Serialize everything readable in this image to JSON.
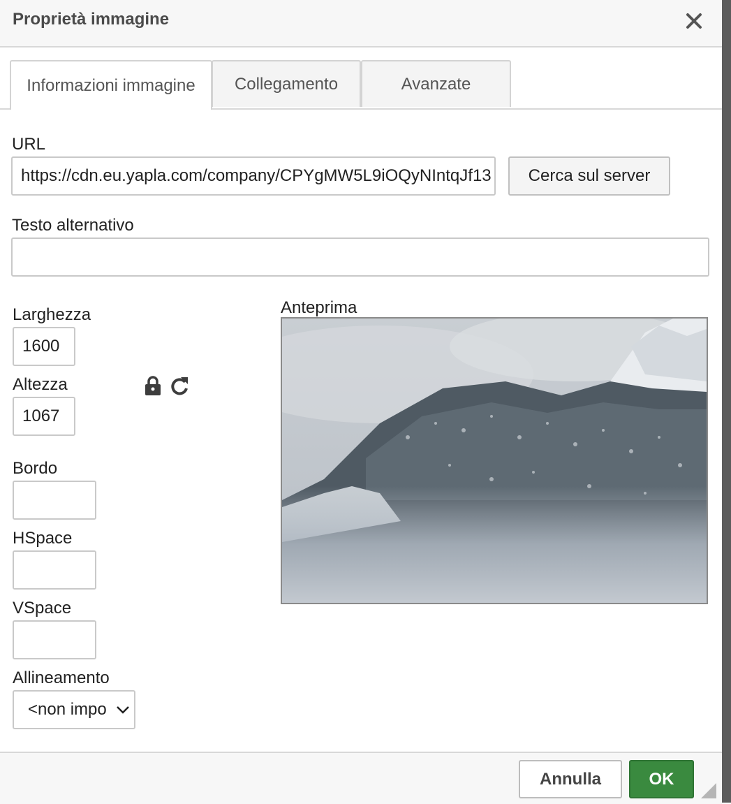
{
  "dialog": {
    "title": "Proprietà immagine",
    "close_icon": "close-icon"
  },
  "tabs": [
    {
      "label": "Informazioni immagine",
      "active": true
    },
    {
      "label": "Collegamento",
      "active": false
    },
    {
      "label": "Avanzate",
      "active": false
    }
  ],
  "fields": {
    "url_label": "URL",
    "url_value": "https://cdn.eu.yapla.com/company/CPYgMW5L9iOQyNIntqJf13",
    "browse_button": "Cerca sul server",
    "alt_label": "Testo alternativo",
    "alt_value": "",
    "width_label": "Larghezza",
    "width_value": "1600",
    "height_label": "Altezza",
    "height_value": "1067",
    "lock_icon": "lock-icon",
    "reset_icon": "reset-size-icon",
    "border_label": "Bordo",
    "border_value": "",
    "hspace_label": "HSpace",
    "hspace_value": "",
    "vspace_label": "VSpace",
    "vspace_value": "",
    "align_label": "Allineamento",
    "align_value": "<non impo"
  },
  "preview": {
    "label": "Anteprima",
    "image": "snowy-forested-mountain-in-fog"
  },
  "footer": {
    "cancel_label": "Annulla",
    "ok_label": "OK",
    "ok_color": "#3a8a3f"
  }
}
